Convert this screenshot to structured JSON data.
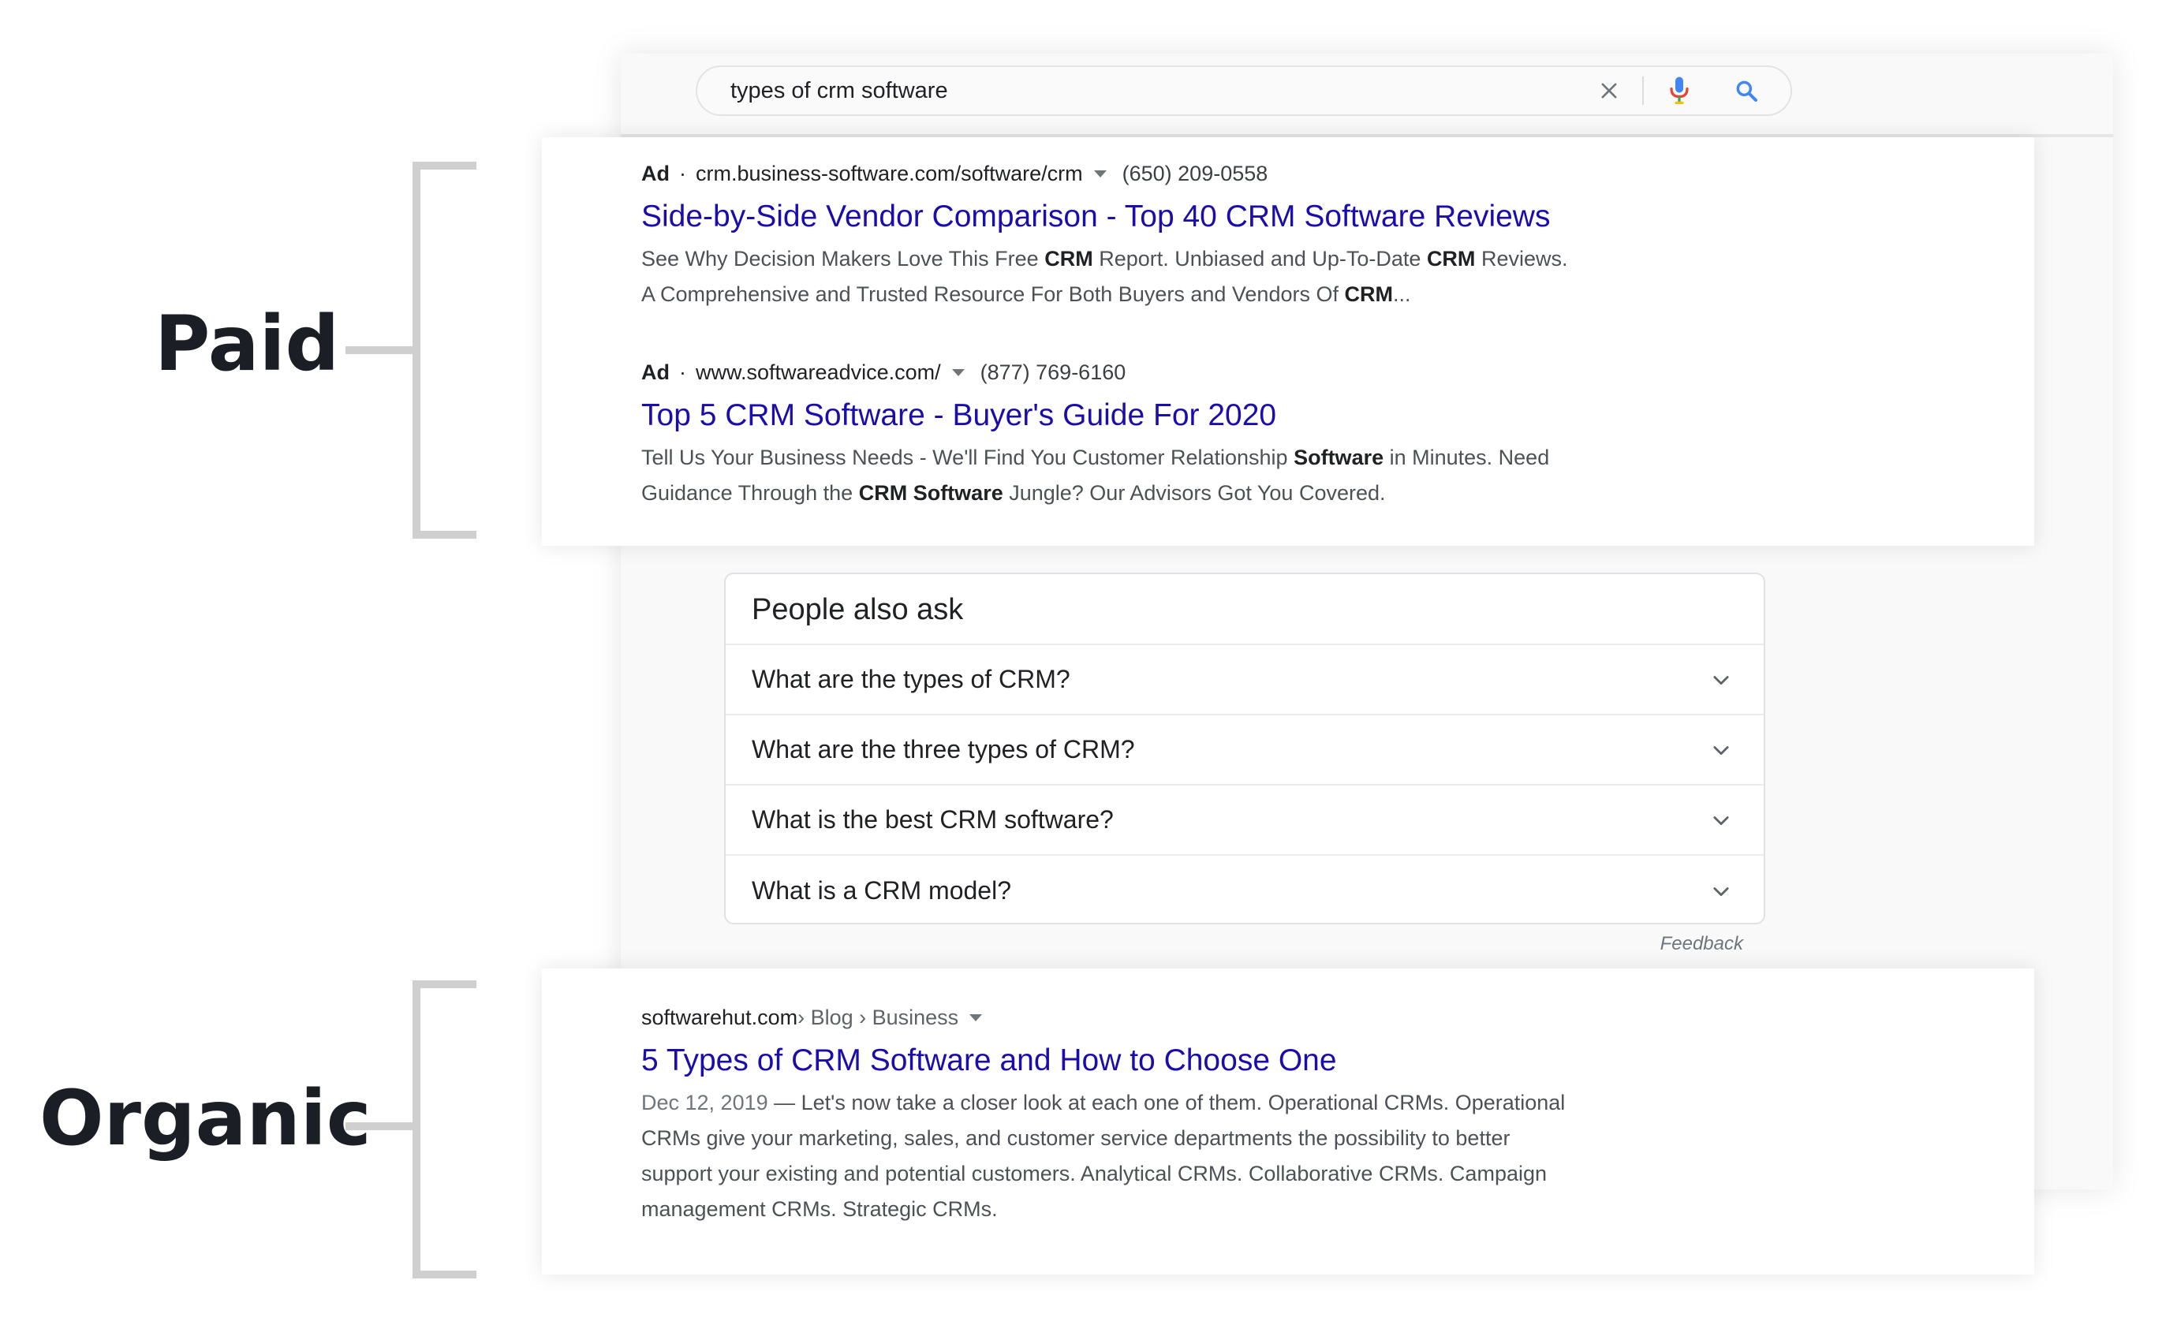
{
  "annotations": {
    "paid_label": "Paid",
    "organic_label": "Organic"
  },
  "search": {
    "query": "types of crm software",
    "icons": {
      "clear": "close-icon",
      "voice": "microphone-icon",
      "submit": "search-icon"
    },
    "colors": {
      "mic_blue": "#4285f4",
      "mic_red": "#ea4335",
      "search_blue": "#4285f4"
    }
  },
  "ads": [
    {
      "label": "Ad",
      "separator": "·",
      "url": "crm.business-software.com/software/crm",
      "phone": "(650) 209-0558",
      "title": "Side-by-Side Vendor Comparison - Top 40 CRM Software Reviews",
      "snippet": {
        "l1a": "See Why Decision Makers Love This Free ",
        "l1b": "CRM",
        "l1c": " Report. Unbiased and Up-To-Date ",
        "l1d": "CRM",
        "l1e": " Reviews.",
        "l2a": "A Comprehensive and Trusted Resource For Both Buyers and Vendors Of ",
        "l2b": "CRM",
        "l2c": "..."
      }
    },
    {
      "label": "Ad",
      "separator": "·",
      "url": "www.softwareadvice.com/",
      "phone": "(877) 769-6160",
      "title": "Top 5 CRM Software - Buyer's Guide For 2020",
      "snippet": {
        "l1a": "Tell Us Your Business Needs - We'll Find You Customer Relationship ",
        "l1b": "Software",
        "l1c": " in Minutes. Need",
        "l2a": "Guidance Through the ",
        "l2b": "CRM Software",
        "l2c": " Jungle? Our Advisors Got You Covered."
      }
    }
  ],
  "paa": {
    "title": "People also ask",
    "questions": [
      "What are the types of CRM?",
      "What are the three types of CRM?",
      "What is the best CRM software?",
      "What is a CRM model?"
    ],
    "feedback": "Feedback"
  },
  "organic": {
    "site": "softwarehut.com",
    "breadcrumb": " › Blog › Business",
    "title": "5 Types of CRM Software and How to Choose One",
    "date": "Dec 12, 2019",
    "dash": " — ",
    "snippet_l1": "Let's now take a closer look at each one of them. Operational CRMs. Operational",
    "snippet_l2": "CRMs give your marketing, sales, and customer service departments the possibility to better",
    "snippet_l3": "support your existing and potential customers. Analytical CRMs. Collaborative CRMs. Campaign",
    "snippet_l4": "management CRMs. Strategic CRMs."
  },
  "colors": {
    "title_link": "#1a0dab",
    "bracket": "#cfcfcf",
    "annotation_text": "#1b1e24"
  }
}
